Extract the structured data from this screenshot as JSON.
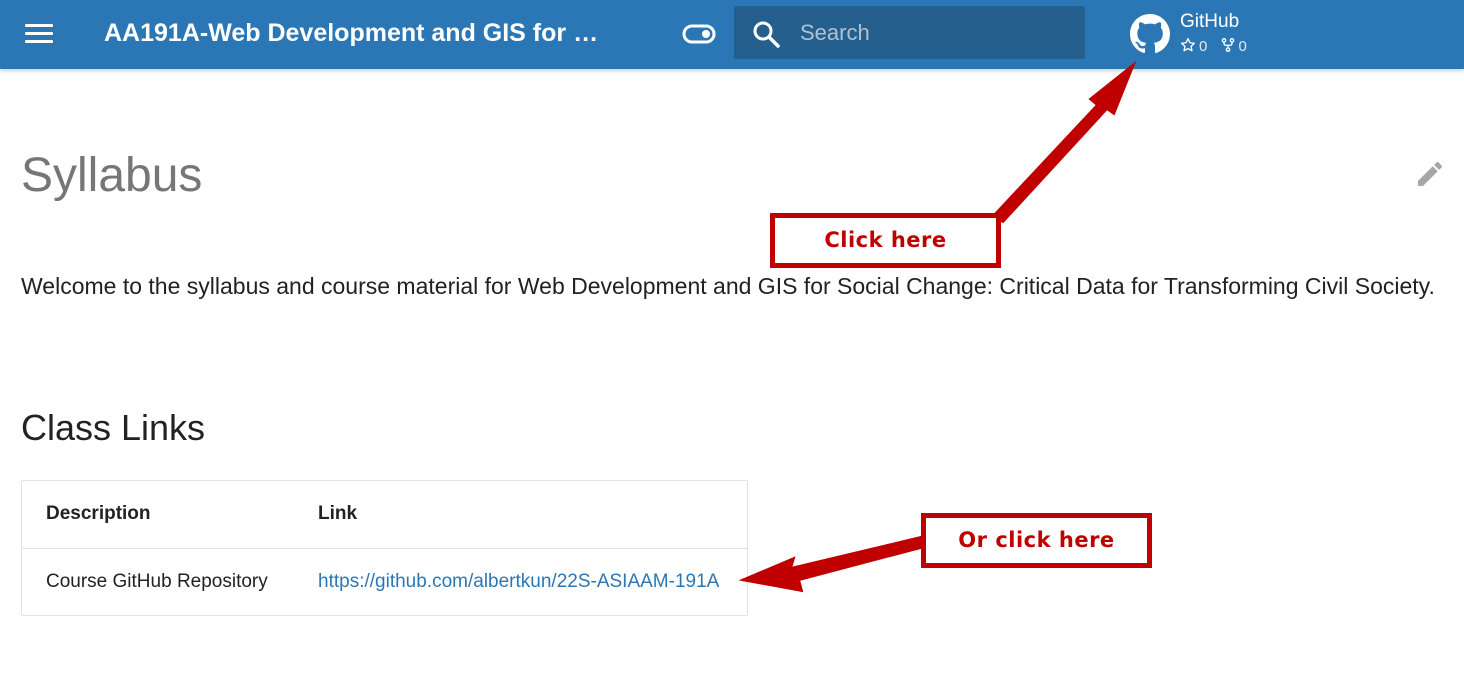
{
  "header": {
    "menu_icon": "menu-icon",
    "site_title": "AA191A-Web Development and GIS for …",
    "toggle_icon": "toggle-icon",
    "search": {
      "icon": "search-icon",
      "placeholder": "Search"
    },
    "source": {
      "icon": "github-icon",
      "name": "GitHub",
      "stars": "0",
      "forks": "0"
    }
  },
  "content": {
    "title": "Syllabus",
    "edit_icon": "pencil-icon",
    "intro": "Welcome to the syllabus and course material for Web Development and GIS for Social Change: Critical Data for Transforming Civil Society.",
    "section_title": "Class Links",
    "table": {
      "headers": [
        "Description",
        "Link"
      ],
      "rows": [
        {
          "description": "Course GitHub Repository",
          "link": "https://github.com/albertkun/22S-ASIAAM-191A"
        }
      ]
    }
  },
  "annotations": {
    "callout_1": "Click here",
    "callout_2": "Or click here",
    "color": "#c00000"
  },
  "colors": {
    "primary": "#2b77b5",
    "search_bg": "#255f8e",
    "title_gray": "#767676",
    "link": "#2b77b5"
  }
}
